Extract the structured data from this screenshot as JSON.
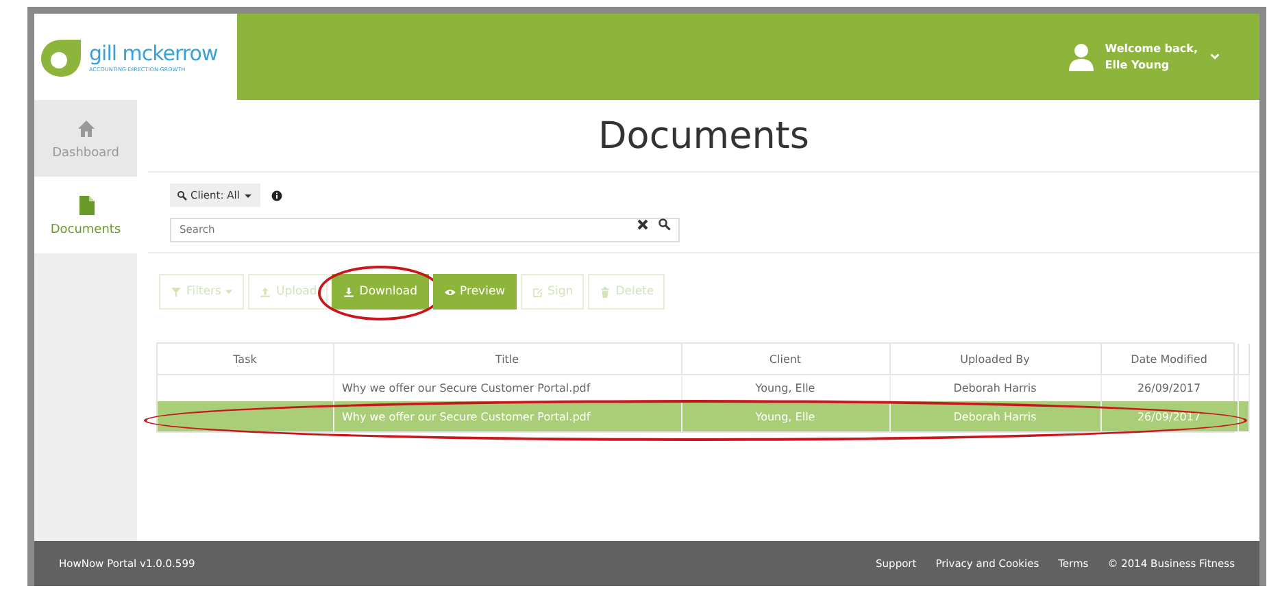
{
  "header": {
    "logo": {
      "name": "gill mckerrow",
      "tagline": "ACCOUNTING·DIRECTION·GROWTH"
    },
    "user": {
      "greeting": "Welcome back,",
      "name": "Elle Young"
    }
  },
  "sidebar": {
    "items": [
      {
        "label": "Dashboard",
        "kind": "home",
        "selected": false
      },
      {
        "label": "Documents",
        "kind": "file",
        "selected": true
      }
    ]
  },
  "page_title": "Documents",
  "search": {
    "client_filter": "Client: All",
    "placeholder": "Search"
  },
  "toolbar": [
    {
      "label": "Filters",
      "kind": "filter",
      "disabled": true,
      "dropdown": true,
      "circled": false
    },
    {
      "label": "Upload",
      "kind": "upload",
      "disabled": true,
      "dropdown": false,
      "circled": false
    },
    {
      "label": "Download",
      "kind": "download",
      "disabled": false,
      "dropdown": false,
      "circled": true
    },
    {
      "label": "Preview",
      "kind": "eye",
      "disabled": false,
      "dropdown": false,
      "circled": false
    },
    {
      "label": "Sign",
      "kind": "edit",
      "disabled": true,
      "dropdown": false,
      "circled": false
    },
    {
      "label": "Delete",
      "kind": "trash",
      "disabled": true,
      "dropdown": false,
      "circled": false
    }
  ],
  "table": {
    "columns": [
      "Task",
      "Title",
      "Client",
      "Uploaded By",
      "Date Modified"
    ],
    "rows": [
      {
        "cells": [
          "",
          "Why we offer our Secure Customer Portal.pdf",
          "Young, Elle",
          "Deborah Harris",
          "26/09/2017"
        ],
        "selected": false,
        "circled": false
      },
      {
        "cells": [
          "",
          "Why we offer our Secure Customer Portal.pdf",
          "Young, Elle",
          "Deborah Harris",
          "26/09/2017"
        ],
        "selected": true,
        "circled": true
      }
    ]
  },
  "footer": {
    "version": "HowNow Portal v1.0.0.599",
    "links": [
      "Support",
      "Privacy and Cookies",
      "Terms",
      "© 2014 Business Fitness"
    ]
  }
}
